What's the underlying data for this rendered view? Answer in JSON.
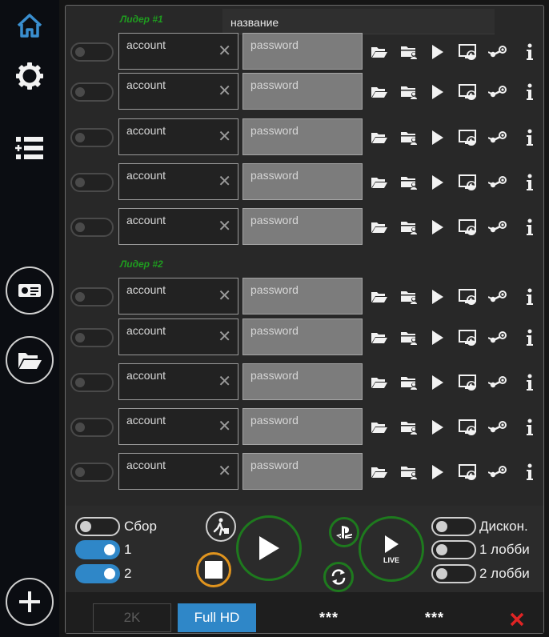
{
  "sidebar": {
    "items": [
      {
        "icon": "home-icon"
      },
      {
        "icon": "gear-icon"
      },
      {
        "icon": "add-list-icon"
      },
      {
        "icon": "id-card-icon"
      },
      {
        "icon": "folder-open-icon"
      },
      {
        "icon": "plus-icon"
      }
    ]
  },
  "header": {
    "name_placeholder": "название"
  },
  "groups": [
    {
      "label": "Лидер #1"
    },
    {
      "label": "Лидер #2"
    }
  ],
  "accounts": [
    {
      "account": "account",
      "password_placeholder": "password"
    },
    {
      "account": "account",
      "password_placeholder": "password"
    },
    {
      "account": "account",
      "password_placeholder": "password"
    },
    {
      "account": "account",
      "password_placeholder": "password"
    },
    {
      "account": "account",
      "password_placeholder": "password"
    },
    {
      "account": "account",
      "password_placeholder": "password"
    },
    {
      "account": "account",
      "password_placeholder": "password"
    },
    {
      "account": "account",
      "password_placeholder": "password"
    },
    {
      "account": "account",
      "password_placeholder": "password"
    },
    {
      "account": "account",
      "password_placeholder": "password"
    }
  ],
  "row_actions": [
    "folder-open-icon",
    "folder-user-icon",
    "play-icon",
    "monitor-refresh-icon",
    "steam-icon",
    "info-icon"
  ],
  "controls": {
    "left_toggles": [
      {
        "label": "Сбор",
        "on": false
      },
      {
        "label": "1",
        "on": true
      },
      {
        "label": "2",
        "on": true
      }
    ],
    "right_toggles": [
      {
        "label": "Дискон.",
        "on": false
      },
      {
        "label": "1 лобби",
        "on": false
      },
      {
        "label": "2 лобби",
        "on": false
      }
    ],
    "live_label": "LIVE"
  },
  "footer": {
    "res_2k": "2K",
    "res_fullhd": "Full HD",
    "stars_1": "***",
    "stars_2": "***"
  },
  "colors": {
    "accent_blue": "#2f87c8",
    "group_green": "#1f9d1f",
    "ring_green": "#1e7a1e",
    "ring_orange": "#e0941e",
    "close_red": "#e02424"
  }
}
